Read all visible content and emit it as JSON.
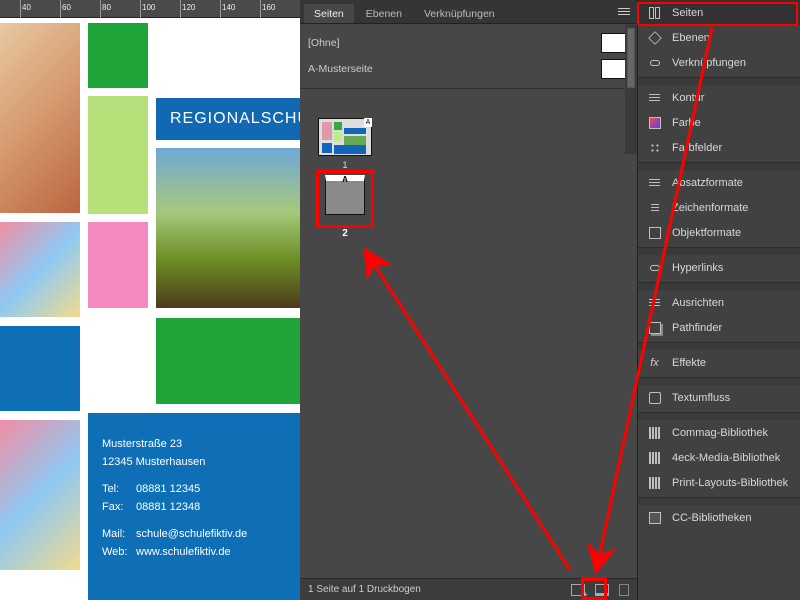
{
  "doc": {
    "banner": "REGIONALSCHU",
    "contact": {
      "street": "Musterstraße 23",
      "city": "12345 Musterhausen",
      "tel_label": "Tel:",
      "tel": "08881 12345",
      "fax_label": "Fax:",
      "fax": "08881 12348",
      "mail_label": "Mail:",
      "mail": "schule@schulefiktiv.de",
      "web_label": "Web:",
      "web": "www.schulefiktiv.de"
    }
  },
  "panel": {
    "tabs": {
      "seiten": "Seiten",
      "ebenen": "Ebenen",
      "verkn": "Verknüpfungen"
    },
    "master_none": "[Ohne]",
    "master_a": "A-Musterseite",
    "page1_num": "1",
    "page2_letter": "A",
    "page2_num": "2",
    "status": "1 Seite auf 1 Druckbogen"
  },
  "side": {
    "seiten": "Seiten",
    "ebenen": "Ebenen",
    "verkn": "Verknüpfungen",
    "kontur": "Kontur",
    "farbe": "Farbe",
    "farbfelder": "Farbfelder",
    "absatz": "Absatzformate",
    "zeichen": "Zeichenformate",
    "objekt": "Objektformate",
    "hyperlinks": "Hyperlinks",
    "ausrichten": "Ausrichten",
    "pathfinder": "Pathfinder",
    "effekte": "Effekte",
    "textumfluss": "Textumfluss",
    "commag": "Commag-Bibliothek",
    "eck4": "4eck-Media-Bibliothek",
    "printlayouts": "Print-Layouts-Bibliothek",
    "cc": "CC-Bibliotheken"
  }
}
